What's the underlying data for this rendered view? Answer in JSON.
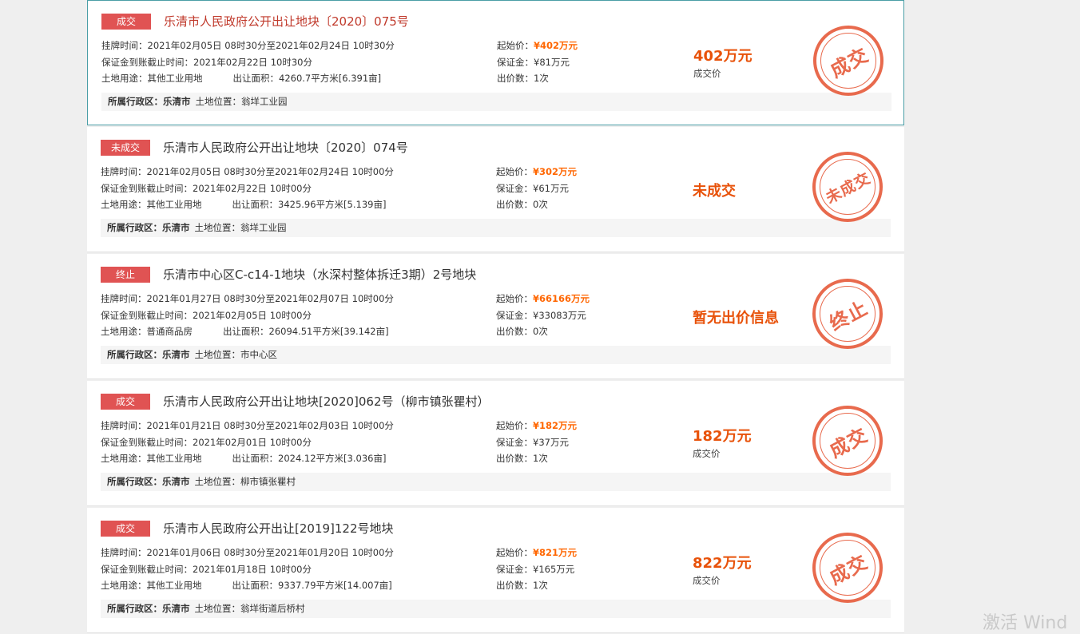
{
  "listings": [
    {
      "status": "成交",
      "title": "乐清市人民政府公开出让地块〔2020〕075号",
      "listing_time_label": "挂牌时间：",
      "listing_time": "2021年02月05日 08时30分至2021年02月24日 10时30分",
      "deposit_deadline_label": "保证金到账截止时间：",
      "deposit_deadline": "2021年02月22日 10时30分",
      "land_use_label": "土地用途：",
      "land_use": "其他工业用地",
      "area_label": "出让面积：",
      "area": "4260.7平方米[6.391亩]",
      "start_price_label": "起始价：",
      "start_price": "¥402万元",
      "deposit_label": "保证金：",
      "deposit": "¥81万元",
      "bid_count_label": "出价数：",
      "bid_count": "1次",
      "region_label": "所属行政区：",
      "region": "乐清市",
      "location_label": "土地位置：",
      "location": "翁垟工业园",
      "result": "402万元",
      "result_sub": "成交价",
      "stamp": "成交"
    },
    {
      "status": "未成交",
      "title": "乐清市人民政府公开出让地块〔2020〕074号",
      "listing_time_label": "挂牌时间：",
      "listing_time": "2021年02月05日 08时30分至2021年02月24日 10时00分",
      "deposit_deadline_label": "保证金到账截止时间：",
      "deposit_deadline": "2021年02月22日 10时00分",
      "land_use_label": "土地用途：",
      "land_use": "其他工业用地",
      "area_label": "出让面积：",
      "area": "3425.96平方米[5.139亩]",
      "start_price_label": "起始价：",
      "start_price": "¥302万元",
      "deposit_label": "保证金：",
      "deposit": "¥61万元",
      "bid_count_label": "出价数：",
      "bid_count": "0次",
      "region_label": "所属行政区：",
      "region": "乐清市",
      "location_label": "土地位置：",
      "location": "翁垟工业园",
      "result": "未成交",
      "result_sub": "",
      "stamp": "未成交"
    },
    {
      "status": "终止",
      "title": "乐清市中心区C-c14-1地块（水深村整体拆迁3期）2号地块",
      "listing_time_label": "挂牌时间：",
      "listing_time": "2021年01月27日 08时30分至2021年02月07日 10时00分",
      "deposit_deadline_label": "保证金到账截止时间：",
      "deposit_deadline": "2021年02月05日 10时00分",
      "land_use_label": "土地用途：",
      "land_use": "普通商品房",
      "area_label": "出让面积：",
      "area": "26094.51平方米[39.142亩]",
      "start_price_label": "起始价：",
      "start_price": "¥66166万元",
      "deposit_label": "保证金：",
      "deposit": "¥33083万元",
      "bid_count_label": "出价数：",
      "bid_count": "0次",
      "region_label": "所属行政区：",
      "region": "乐清市",
      "location_label": "土地位置：",
      "location": "市中心区",
      "result": "暂无出价信息",
      "result_sub": "",
      "stamp": "终止"
    },
    {
      "status": "成交",
      "title": "乐清市人民政府公开出让地块[2020]062号（柳市镇张瞿村）",
      "listing_time_label": "挂牌时间：",
      "listing_time": "2021年01月21日 08时30分至2021年02月03日 10时00分",
      "deposit_deadline_label": "保证金到账截止时间：",
      "deposit_deadline": "2021年02月01日 10时00分",
      "land_use_label": "土地用途：",
      "land_use": "其他工业用地",
      "area_label": "出让面积：",
      "area": "2024.12平方米[3.036亩]",
      "start_price_label": "起始价：",
      "start_price": "¥182万元",
      "deposit_label": "保证金：",
      "deposit": "¥37万元",
      "bid_count_label": "出价数：",
      "bid_count": "1次",
      "region_label": "所属行政区：",
      "region": "乐清市",
      "location_label": "土地位置：",
      "location": "柳市镇张瞿村",
      "result": "182万元",
      "result_sub": "成交价",
      "stamp": "成交"
    },
    {
      "status": "成交",
      "title": "乐清市人民政府公开出让[2019]122号地块",
      "listing_time_label": "挂牌时间：",
      "listing_time": "2021年01月06日 08时30分至2021年01月20日 10时00分",
      "deposit_deadline_label": "保证金到账截止时间：",
      "deposit_deadline": "2021年01月18日 10时00分",
      "land_use_label": "土地用途：",
      "land_use": "其他工业用地",
      "area_label": "出让面积：",
      "area": "9337.79平方米[14.007亩]",
      "start_price_label": "起始价：",
      "start_price": "¥821万元",
      "deposit_label": "保证金：",
      "deposit": "¥165万元",
      "bid_count_label": "出价数：",
      "bid_count": "1次",
      "region_label": "所属行政区：",
      "region": "乐清市",
      "location_label": "土地位置：",
      "location": "翁垟街道后桥村",
      "result": "822万元",
      "result_sub": "成交价",
      "stamp": "成交"
    }
  ],
  "watermark": "激活 Wind",
  "colors": {
    "badge_bg": "#e05353",
    "price": "#ff6600",
    "result": "#e8520a",
    "stamp": "#e86a4d",
    "active_border": "#4a9ea6"
  }
}
